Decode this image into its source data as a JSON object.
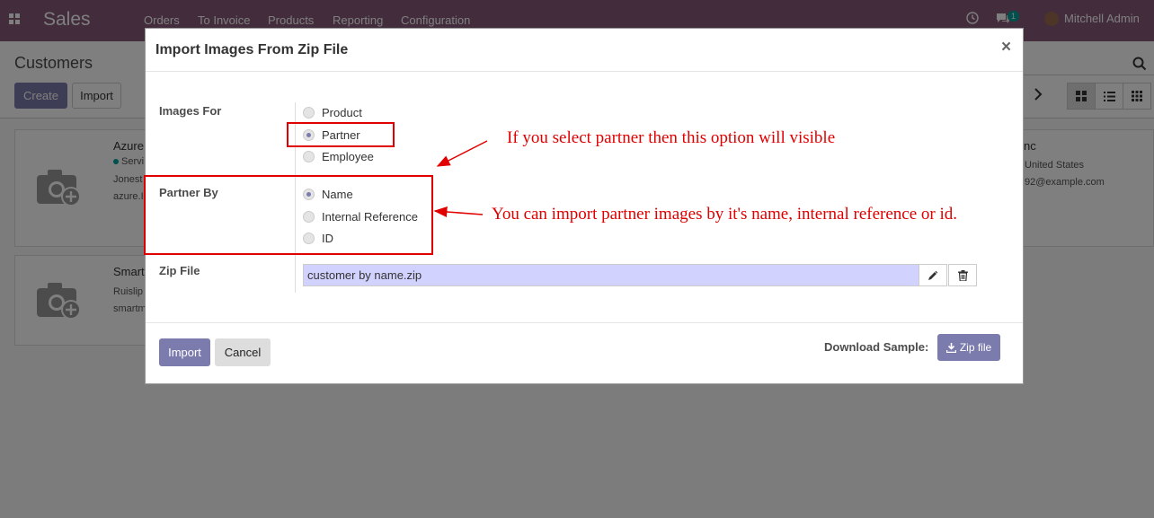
{
  "navbar": {
    "app_title": "Sales",
    "menu": [
      "Orders",
      "To Invoice",
      "Products",
      "Reporting",
      "Configuration"
    ],
    "messages_count": "1",
    "user_name": "Mitchell Admin"
  },
  "control_panel": {
    "title": "Customers",
    "create_label": "Create",
    "import_label": "Import"
  },
  "kanban": {
    "cards": [
      {
        "name": "Azure",
        "tag": "Servi",
        "line1": "Jonest",
        "line2": "azure.I"
      },
      {
        "name": "Smart",
        "line1": "Ruislip",
        "line2": "smartm"
      },
      {
        "name": "nc",
        "line1": "United States",
        "line2": "92@example.com"
      }
    ]
  },
  "modal": {
    "title": "Import Images From Zip File",
    "close": "×",
    "images_for_label": "Images For",
    "images_for_options": [
      "Product",
      "Partner",
      "Employee"
    ],
    "images_for_selected": "Partner",
    "partner_by_label": "Partner By",
    "partner_by_options": [
      "Name",
      "Internal Reference",
      "ID"
    ],
    "partner_by_selected": "Name",
    "zip_label": "Zip File",
    "zip_value": "customer by name.zip",
    "import_label": "Import",
    "cancel_label": "Cancel",
    "download_sample_label": "Download Sample:",
    "zip_file_button": "Zip file"
  },
  "annotations": {
    "note1": "If you select partner then this option will visible",
    "note2": "You can import partner images by it's name, internal reference or id."
  },
  "colors": {
    "brand": "#875A7B",
    "primary": "#7C7BAD",
    "annotation": "#e00000",
    "zip_field_bg": "#d2d2ff"
  }
}
